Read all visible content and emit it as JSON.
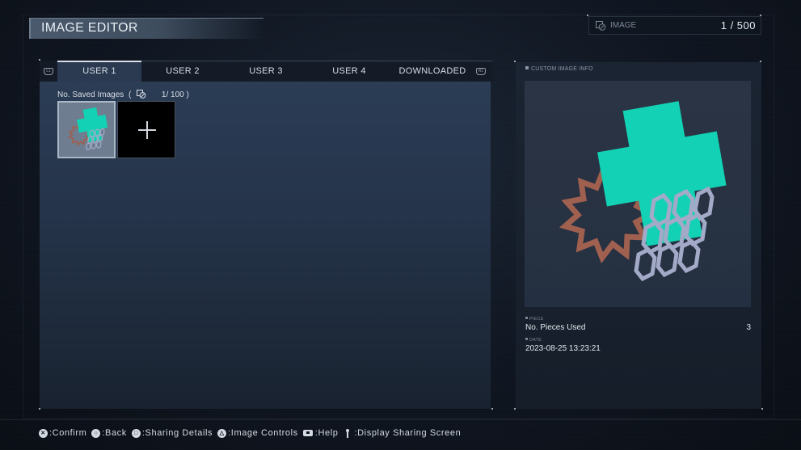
{
  "header": {
    "title": "IMAGE EDITOR",
    "image_counter": {
      "icon": "image-icon",
      "label": "IMAGE",
      "value": "1 / 500"
    }
  },
  "tabs": {
    "left_bumper": "L1",
    "right_bumper": "R1",
    "items": [
      {
        "label": "USER 1",
        "active": true
      },
      {
        "label": "USER 2",
        "active": false
      },
      {
        "label": "USER 3",
        "active": false
      },
      {
        "label": "USER 4",
        "active": false
      },
      {
        "label": "DOWNLOADED",
        "active": false
      }
    ]
  },
  "saved_images": {
    "label": "No. Saved Images",
    "open_paren": "(",
    "count": "1/ 100 )",
    "thumbnails": [
      {
        "type": "custom-image",
        "selected": true
      },
      {
        "type": "create-new",
        "icon": "plus-icon"
      }
    ]
  },
  "info_panel": {
    "heading": "CUSTOM IMAGE INFO",
    "pieces": {
      "section_label": "PIECE",
      "label": "No. Pieces Used",
      "value": "3"
    },
    "date": {
      "section_label": "DATE",
      "value": "2023-08-25 13:23:21"
    },
    "colors": {
      "cross": "#12d1b4",
      "starburst": "#a0604f",
      "hexagons": "#a3aac8"
    }
  },
  "footer": {
    "hints": [
      {
        "icon": "cross-button-icon",
        "glyph": "✕",
        "label": ":Confirm"
      },
      {
        "icon": "circle-button-icon",
        "glyph": "○",
        "label": ":Back"
      },
      {
        "icon": "square-button-icon",
        "glyph": "□",
        "label": ":Sharing Details"
      },
      {
        "icon": "triangle-button-icon",
        "glyph": "△",
        "label": ":Image Controls"
      },
      {
        "icon": "touchpad-icon",
        "glyph": "",
        "label": ":Help"
      },
      {
        "icon": "stick-icon",
        "glyph": "",
        "label": ":Display Sharing Screen"
      }
    ]
  }
}
